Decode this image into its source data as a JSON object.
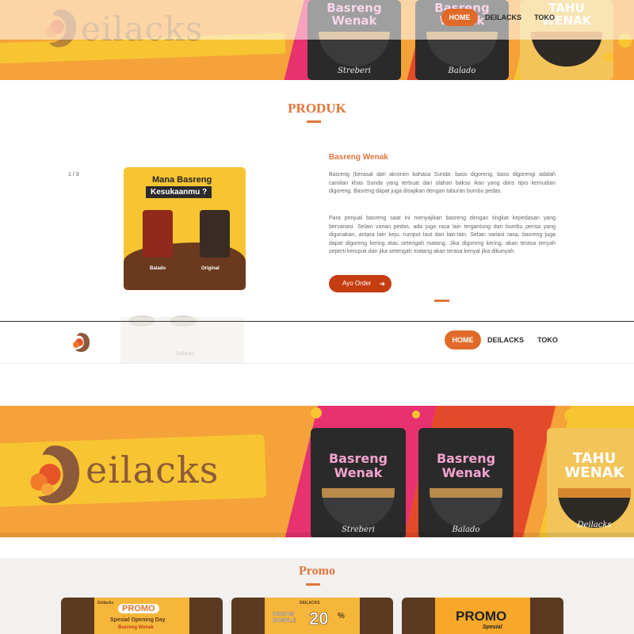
{
  "brand": {
    "name": "Deilacks",
    "logo_text": "eilacks",
    "logo_initial": "D"
  },
  "nav": {
    "items": [
      {
        "label": "HOME",
        "active": true
      },
      {
        "label": "DEILACKS",
        "active": false
      },
      {
        "label": "TOKO",
        "active": false
      }
    ]
  },
  "banner": {
    "packs": [
      {
        "name_line1": "Basreng",
        "name_line2": "Wenak",
        "flavor": "Streberi"
      },
      {
        "name_line1": "Basreng",
        "name_line2": "Wenak",
        "flavor": "Balado"
      },
      {
        "name_line1": "TAHU",
        "name_line2": "WENAK",
        "brand": "Deilacks"
      }
    ]
  },
  "produk": {
    "title": "PRODUK",
    "slider_count": "1 / 3",
    "image": {
      "line1": "Mana Basreng",
      "line2": "Kesukaanmu ?",
      "label_left": "Balado",
      "label_right": "Original"
    },
    "name": "Basreng Wenak",
    "paragraph1": "Basreng (berasal dari akronim bahasa Sunda: baso digoreng, baso digorengi adalah camilan khas Sunda yang terbuat dari olahan bakso ikan yang diiris tipis kemudian digoreng. Basreng dapat juga disajikan dengan taburan bumbu pedas.",
    "paragraph2": "Para penjual basreng saat ini menyajikan basreng dengan tingkat kepedasan yang bervariasi. Selain varian pedas, ada juga rasa lain tergantung dari bumbu perisa yang digunakan, antara lain keju, rumput laut dan lain-lain. Selain variasi rasa, basreng juga dapat digoreng kering atau setengah matang. Jika digoreng kering, akan terasa renyah seperti kerupuk dan jika setengah matang akan terasa kenyal jika dikunyah.",
    "order_button": "Ayo Order",
    "ghost_label": "Deilacks"
  },
  "promo": {
    "title": "Promo",
    "tiles": [
      {
        "brand": "Deilacks",
        "headline": "PROMO",
        "sub": "Spesial Opening Day",
        "sub2": "Basreng Wenak"
      },
      {
        "brand": "DEILACKS",
        "headline": "DISKON BUNDLE",
        "value": "20",
        "unit": "%"
      },
      {
        "headline": "PROMO",
        "sub": "Spesial"
      }
    ]
  },
  "colors": {
    "accent": "#e0763a",
    "button": "#c53e12",
    "banner_orange": "#f5a23a",
    "banner_yellow": "#f7c531",
    "logo_brown": "#8c5a3a"
  }
}
